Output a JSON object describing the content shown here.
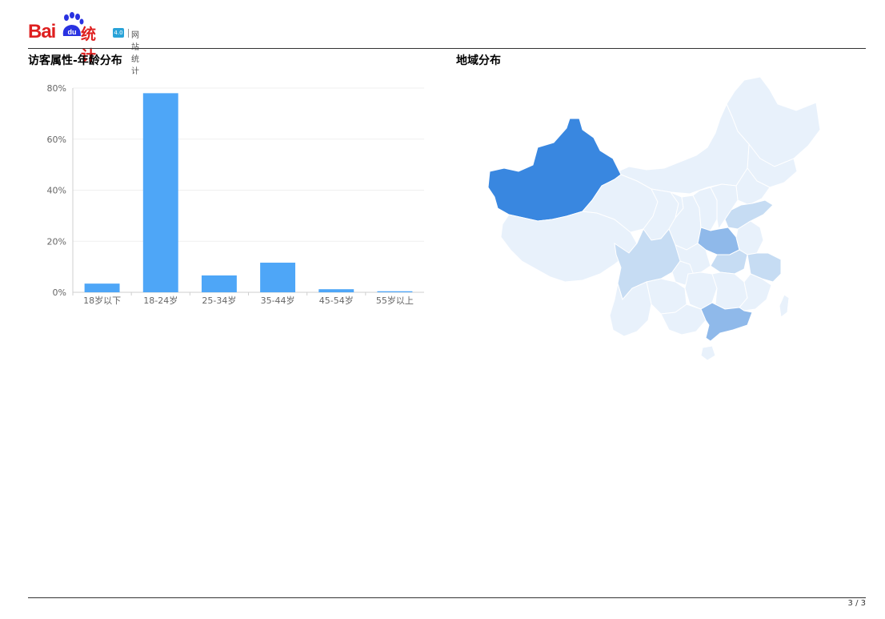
{
  "header": {
    "logo_text": "Bai",
    "logo_du": "du",
    "logo_cn": "统计",
    "badge_text": "4.0",
    "subtitle": "网站统计"
  },
  "sections": {
    "age_title": "访客属性-年龄分布",
    "region_title": "地域分布"
  },
  "colors": {
    "bar": "#4ea6f7",
    "map_base": "#e8f1fb",
    "map_low": "#c6dcf3",
    "map_mid": "#8fb9ea",
    "map_high": "#3987e0",
    "brand_red": "#de1f1f"
  },
  "chart_data": {
    "type": "bar",
    "categories": [
      "18岁以下",
      "18-24岁",
      "25-34岁",
      "35-44岁",
      "45-54岁",
      "55岁以上"
    ],
    "values": [
      3.4,
      78.0,
      6.6,
      11.6,
      1.2,
      0.4
    ],
    "ylim": [
      0,
      80
    ],
    "yticks": [
      "0%",
      "20%",
      "40%",
      "60%",
      "80%"
    ],
    "grid": true
  },
  "map_data": {
    "type": "choropleth",
    "regions": [
      {
        "name": "新疆",
        "level": "high"
      },
      {
        "name": "河南",
        "level": "mid"
      },
      {
        "name": "广东",
        "level": "mid"
      },
      {
        "name": "四川",
        "level": "low"
      },
      {
        "name": "山东",
        "level": "low"
      },
      {
        "name": "安徽",
        "level": "low"
      },
      {
        "name": "浙江",
        "level": "low"
      }
    ]
  },
  "footer": {
    "page": "3 / 3"
  }
}
